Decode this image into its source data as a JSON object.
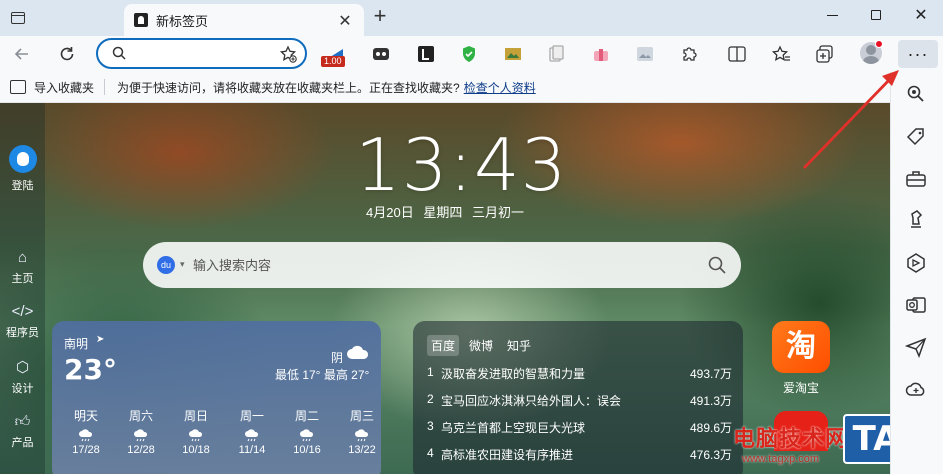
{
  "tab": {
    "title": "新标签页"
  },
  "toolbar": {
    "ext_badge": "1.00",
    "more_label": "···"
  },
  "favorites_bar": {
    "import_label": "导入收藏夹",
    "hint": "为便于快速访问，请将收藏夹放在收藏夹栏上。正在查找收藏夹?",
    "link": "检查个人资料"
  },
  "left_rail": {
    "items": [
      {
        "label": "登陆",
        "icon": "bird-avatar-icon"
      },
      {
        "label": "主页",
        "icon": "home-icon"
      },
      {
        "label": "程序员",
        "icon": "code-icon"
      },
      {
        "label": "设计",
        "icon": "cube-icon"
      },
      {
        "label": "产品",
        "icon": "thumbs-up-icon"
      }
    ]
  },
  "clock": {
    "time": "13:43",
    "date": "4月20日",
    "weekday": "星期四",
    "lunar": "三月初一"
  },
  "search": {
    "placeholder": "输入搜索内容",
    "engine_icon": "baidu-paw-icon"
  },
  "weather": {
    "city": "南明",
    "temp": "23°",
    "condition": "阴",
    "range": "最低 17° 最高 27°",
    "forecast": [
      {
        "day": "明天",
        "range": "17/28"
      },
      {
        "day": "周六",
        "range": "12/28"
      },
      {
        "day": "周日",
        "range": "10/18"
      },
      {
        "day": "周一",
        "range": "11/14"
      },
      {
        "day": "周二",
        "range": "10/16"
      },
      {
        "day": "周三",
        "range": "13/22"
      }
    ]
  },
  "hotlist": {
    "tabs": [
      "百度",
      "微博",
      "知乎"
    ],
    "active_tab": 0,
    "rows": [
      {
        "n": "1",
        "title": "汲取奋发进取的智慧和力量",
        "value": "493.7万"
      },
      {
        "n": "2",
        "title": "宝马回应冰淇淋只给外国人：误会",
        "value": "491.3万"
      },
      {
        "n": "3",
        "title": "乌克兰首都上空现巨大光球",
        "value": "489.6万"
      },
      {
        "n": "4",
        "title": "高标准农田建设有序推进",
        "value": "476.3万"
      }
    ]
  },
  "apps": {
    "taobao_glyph": "淘",
    "taobao_label": "爱淘宝"
  },
  "watermark": {
    "text": "电脑技术网",
    "url": "www.tagxp.com",
    "tag": "TAG"
  },
  "colors": {
    "accent": "#0f6cbd",
    "arrow": "#e0302a",
    "taobao": "#ff5a00"
  }
}
